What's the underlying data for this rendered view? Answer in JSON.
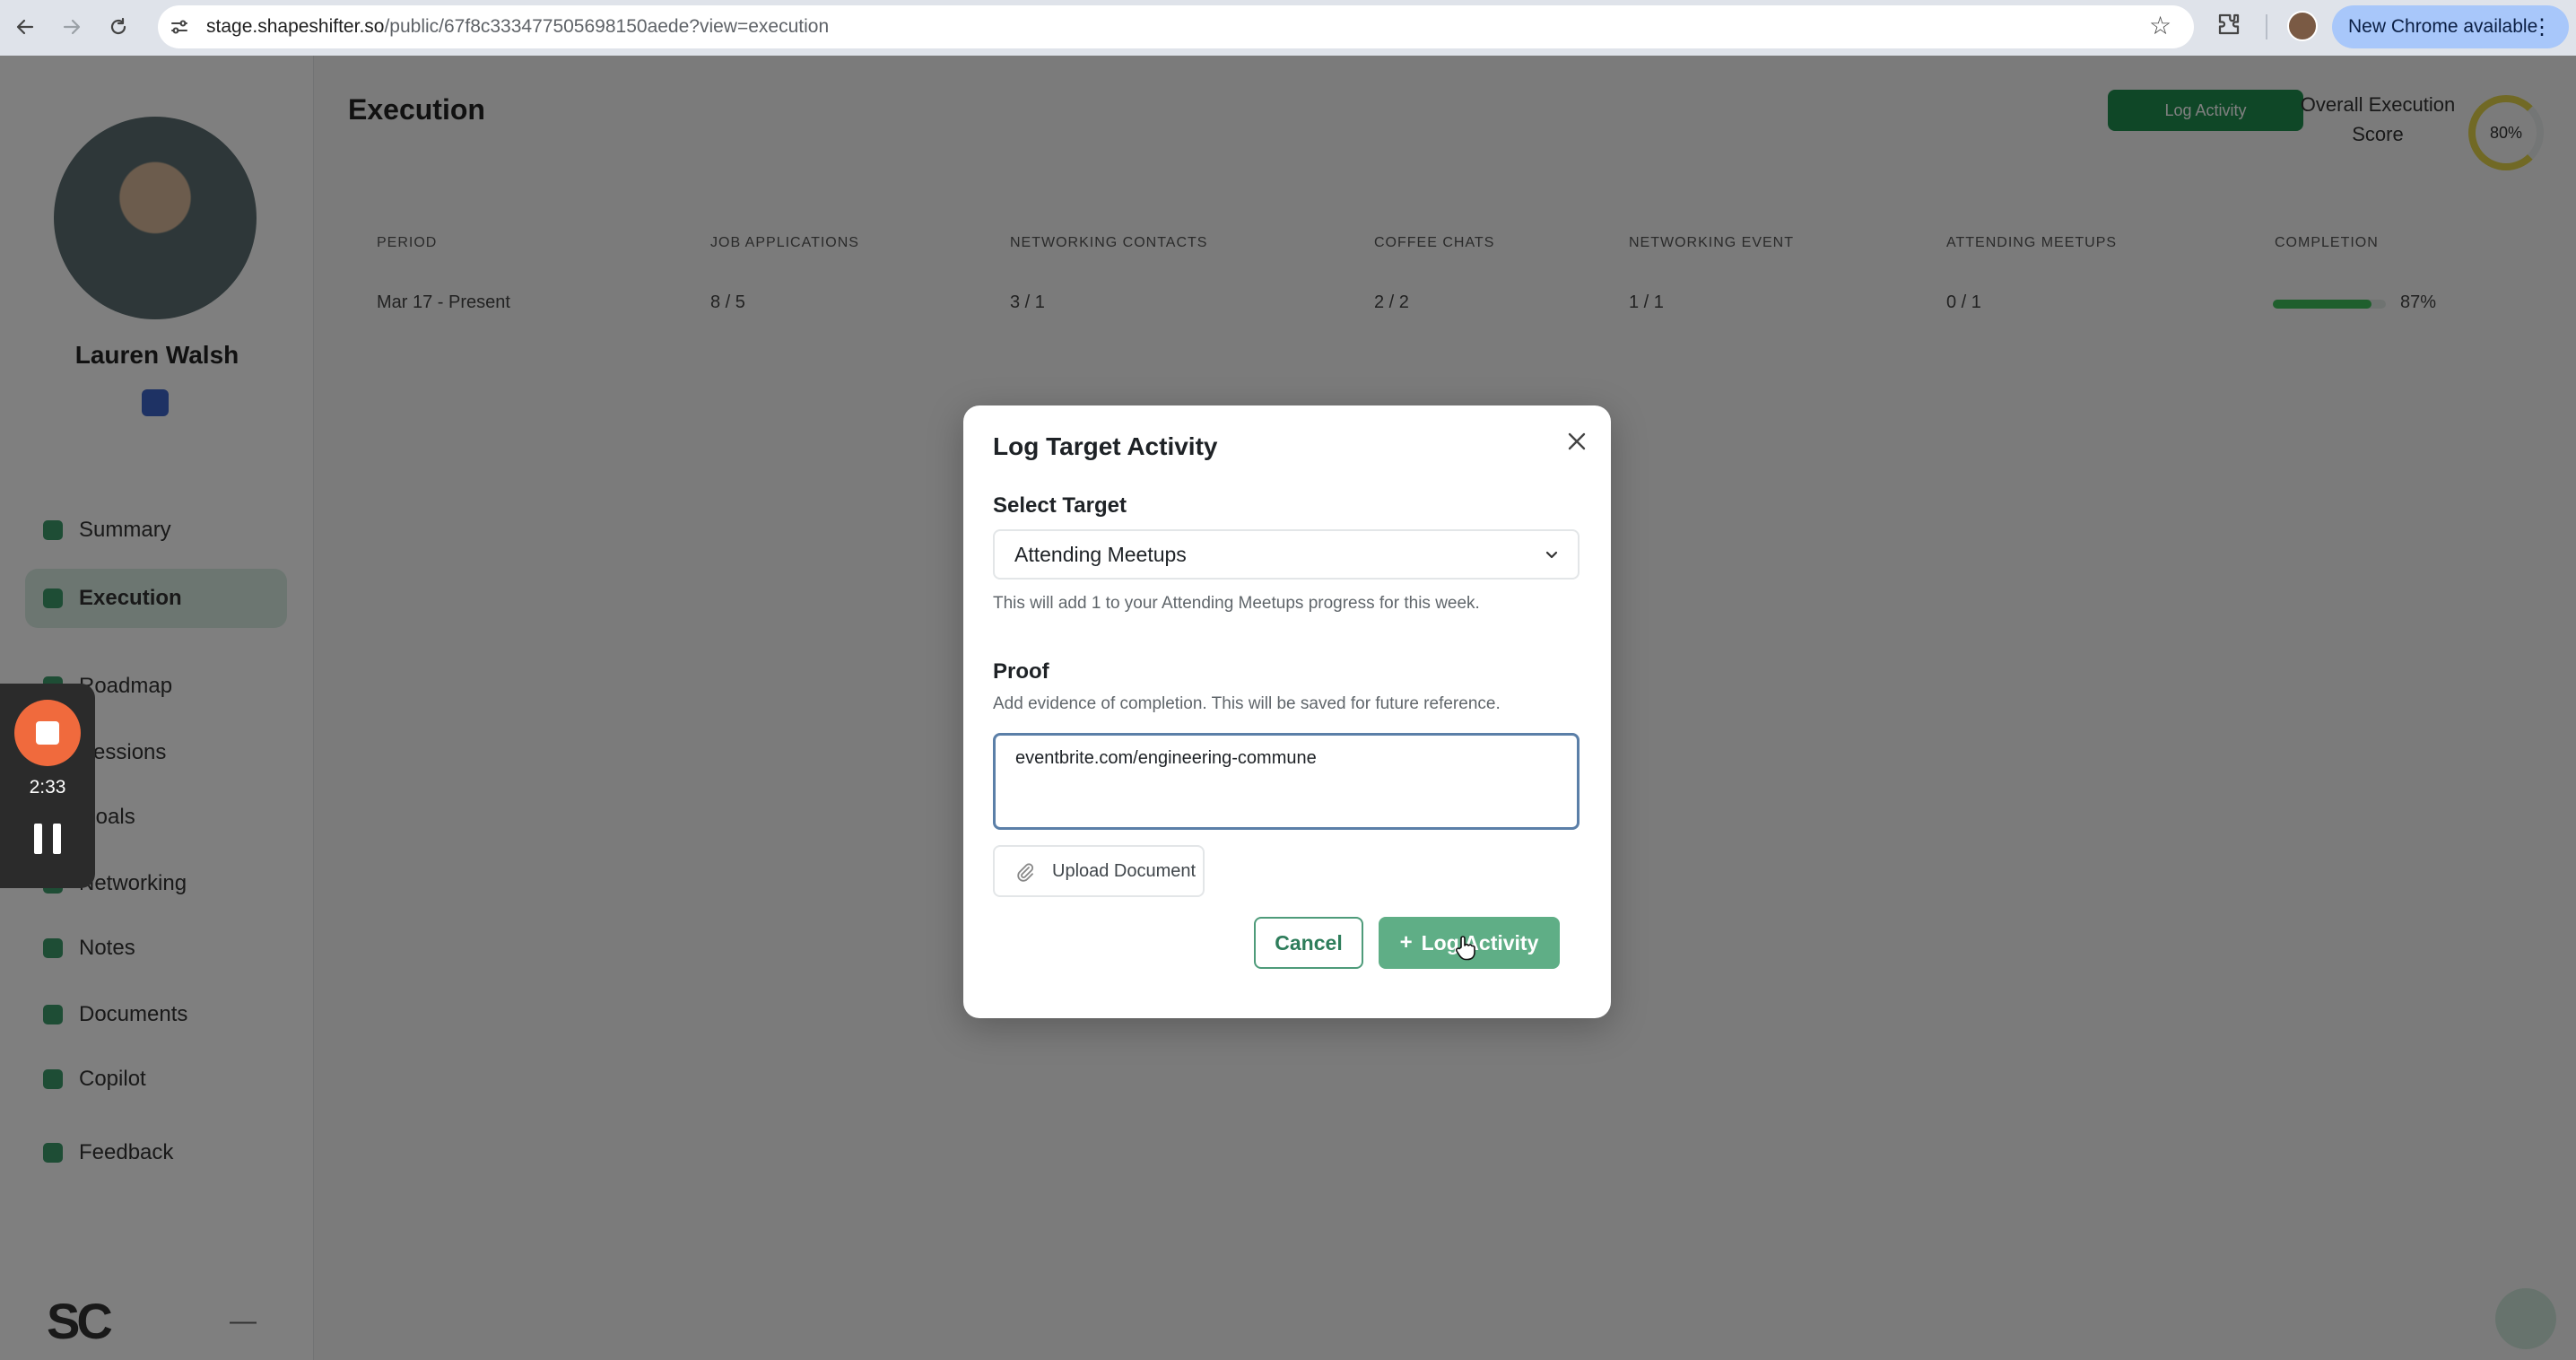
{
  "browser": {
    "url_host": "stage.shapeshifter.so",
    "url_path": "/public/67f8c333477505698150aede?view=execution",
    "update_label": "New Chrome available"
  },
  "sidebar": {
    "user_name": "Lauren Walsh",
    "items": [
      {
        "label": "Summary"
      },
      {
        "label": "Execution"
      },
      {
        "label": "Roadmap"
      },
      {
        "label": "Sessions"
      },
      {
        "label": "Goals"
      },
      {
        "label": "Networking"
      },
      {
        "label": "Notes"
      },
      {
        "label": "Documents"
      },
      {
        "label": "Copilot"
      },
      {
        "label": "Feedback"
      }
    ]
  },
  "main": {
    "title": "Execution",
    "log_activity_label": "Log Activity",
    "score_label": "Overall Execution Score",
    "score_value": "80%",
    "table": {
      "headers": [
        "PERIOD",
        "JOB APPLICATIONS",
        "NETWORKING CONTACTS",
        "COFFEE CHATS",
        "NETWORKING EVENT",
        "ATTENDING MEETUPS",
        "COMPLETION"
      ],
      "row": [
        "Mar 17 - Present",
        "8 / 5",
        "3 / 1",
        "2 / 2",
        "1 / 1",
        "0 / 1",
        "87%"
      ],
      "completion_fraction": 0.87
    }
  },
  "recorder": {
    "time": "2:33"
  },
  "modal": {
    "title": "Log Target Activity",
    "select_label": "Select Target",
    "selected_target": "Attending Meetups",
    "target_help": "This will add 1 to your Attending Meetups progress for this week.",
    "proof_label": "Proof",
    "proof_help": "Add evidence of completion. This will be saved for future reference.",
    "proof_value": "eventbrite.com/engineering-commune",
    "upload_label": "Upload Document",
    "cancel_label": "Cancel",
    "submit_label": "Log Activity"
  },
  "colors": {
    "accent_green": "#5fae86",
    "focus_border": "#5b7fa8",
    "recorder_stop": "#f06a3d"
  }
}
